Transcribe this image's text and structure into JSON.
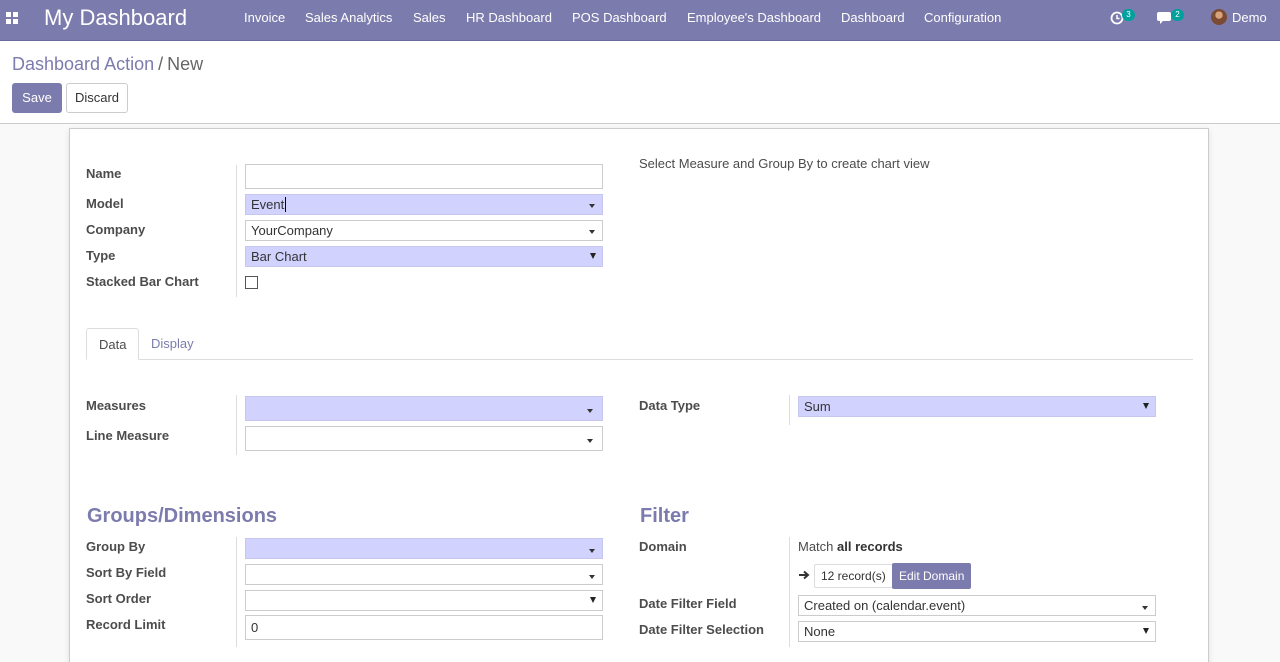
{
  "navbar": {
    "brand": "My Dashboard",
    "menu": [
      "Invoice",
      "Sales Analytics",
      "Sales",
      "HR Dashboard",
      "POS Dashboard",
      "Employee's Dashboard",
      "Dashboard",
      "Configuration"
    ],
    "activity_count": "3",
    "message_count": "2",
    "user": "Demo"
  },
  "breadcrumb": {
    "parent": "Dashboard Action",
    "separator": "/",
    "current": "New"
  },
  "buttons": {
    "save": "Save",
    "discard": "Discard"
  },
  "form": {
    "name_label": "Name",
    "name_value": "",
    "model_label": "Model",
    "model_value": "Event",
    "company_label": "Company",
    "company_value": "YourCompany",
    "type_label": "Type",
    "type_value": "Bar Chart",
    "stacked_label": "Stacked Bar Chart",
    "stacked_checked": false,
    "chart_hint": "Select Measure and Group By to create chart view"
  },
  "tabs": [
    {
      "label": "Data",
      "active": true
    },
    {
      "label": "Display",
      "active": false
    }
  ],
  "data_tab": {
    "measures_label": "Measures",
    "measures_value": "",
    "line_measure_label": "Line Measure",
    "line_measure_value": "",
    "data_type_label": "Data Type",
    "data_type_value": "Sum"
  },
  "groups": {
    "title": "Groups/Dimensions",
    "group_by_label": "Group By",
    "group_by_value": "",
    "sort_by_label": "Sort By Field",
    "sort_by_value": "",
    "sort_order_label": "Sort Order",
    "sort_order_value": "",
    "record_limit_label": "Record Limit",
    "record_limit_value": "0"
  },
  "filter": {
    "title": "Filter",
    "domain_label": "Domain",
    "domain_prefix": "Match",
    "domain_scope": "all records",
    "records_count": "12 record(s)",
    "edit_domain": "Edit Domain",
    "date_filter_field_label": "Date Filter Field",
    "date_filter_field_value": "Created on (calendar.event)",
    "date_filter_selection_label": "Date Filter Selection",
    "date_filter_selection_value": "None"
  },
  "colors": {
    "primary": "#7c7bad",
    "required_field": "#d2d2ff",
    "badge": "#00a09d"
  }
}
